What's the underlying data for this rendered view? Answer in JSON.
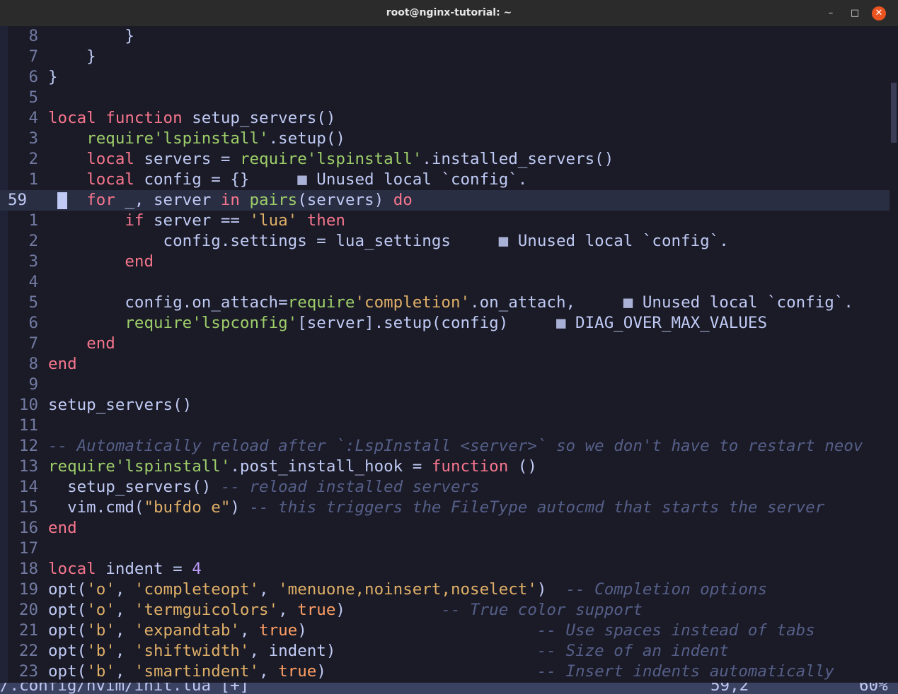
{
  "window": {
    "title": "root@nginx-tutorial: ~",
    "minimize_glyph": "–",
    "maximize_glyph": "□",
    "close_glyph": "✕"
  },
  "editor": {
    "cursor_line": "59",
    "lines": [
      {
        "ln": "8",
        "tokens": [
          [
            "        }",
            ""
          ]
        ]
      },
      {
        "ln": "7",
        "tokens": [
          [
            "    }",
            ""
          ]
        ]
      },
      {
        "ln": "6",
        "tokens": [
          [
            "}",
            ""
          ]
        ]
      },
      {
        "ln": "5",
        "tokens": []
      },
      {
        "ln": "4",
        "tokens": [
          [
            "local",
            "kw"
          ],
          [
            " ",
            ""
          ],
          [
            "function",
            "kw"
          ],
          [
            " setup_servers()",
            ""
          ]
        ]
      },
      {
        "ln": "3",
        "tokens": [
          [
            "    ",
            ""
          ],
          [
            "require",
            "req"
          ],
          [
            "'lspinstall'",
            "str"
          ],
          [
            ".setup()",
            ""
          ]
        ]
      },
      {
        "ln": "2",
        "tokens": [
          [
            "    ",
            ""
          ],
          [
            "local",
            "kw"
          ],
          [
            " servers = ",
            ""
          ],
          [
            "require",
            "req"
          ],
          [
            "'lspinstall'",
            "str"
          ],
          [
            ".installed_servers()",
            ""
          ]
        ]
      },
      {
        "ln": "1",
        "tokens": [
          [
            "    ",
            ""
          ],
          [
            "local",
            "kw"
          ],
          [
            " config = {}     ",
            ""
          ],
          [
            "■",
            "diagsq"
          ],
          [
            " Unused local `config`.",
            "diag"
          ]
        ]
      },
      {
        "ln": "59",
        "current": true,
        "tokens": [
          [
            "    ",
            ""
          ],
          [
            "for",
            "kw"
          ],
          [
            " _, server ",
            ""
          ],
          [
            "in",
            "kw"
          ],
          [
            " ",
            ""
          ],
          [
            "pairs",
            "req"
          ],
          [
            "(servers) ",
            ""
          ],
          [
            "do",
            "kw"
          ]
        ]
      },
      {
        "ln": "1",
        "tokens": [
          [
            "        ",
            ""
          ],
          [
            "if",
            "kw"
          ],
          [
            " server == ",
            ""
          ],
          [
            "'lua'",
            "str2"
          ],
          [
            " ",
            ""
          ],
          [
            "then",
            "kw"
          ]
        ]
      },
      {
        "ln": "2",
        "tokens": [
          [
            "            config.settings = lua_settings     ",
            ""
          ],
          [
            "■",
            "diagsq"
          ],
          [
            " Unused local `config`.",
            "diag"
          ]
        ]
      },
      {
        "ln": "3",
        "tokens": [
          [
            "        ",
            ""
          ],
          [
            "end",
            "kw"
          ]
        ]
      },
      {
        "ln": "4",
        "tokens": []
      },
      {
        "ln": "5",
        "tokens": [
          [
            "        config.on_attach=",
            ""
          ],
          [
            "require",
            "req"
          ],
          [
            "'completion'",
            "str2"
          ],
          [
            ".on_attach,     ",
            ""
          ],
          [
            "■",
            "diagsq"
          ],
          [
            " Unused local `config`.",
            "diag"
          ]
        ]
      },
      {
        "ln": "6",
        "tokens": [
          [
            "        ",
            ""
          ],
          [
            "require",
            "req"
          ],
          [
            "'lspconfig'",
            "str"
          ],
          [
            "[server].setup(config)     ",
            ""
          ],
          [
            "■",
            "diagsq"
          ],
          [
            " DIAG_OVER_MAX_VALUES",
            "diag"
          ]
        ]
      },
      {
        "ln": "7",
        "tokens": [
          [
            "    ",
            ""
          ],
          [
            "end",
            "kw"
          ]
        ]
      },
      {
        "ln": "8",
        "tokens": [
          [
            "end",
            "kw"
          ]
        ]
      },
      {
        "ln": "9",
        "tokens": []
      },
      {
        "ln": "10",
        "tokens": [
          [
            "setup_servers()",
            ""
          ]
        ]
      },
      {
        "ln": "11",
        "tokens": []
      },
      {
        "ln": "12",
        "tokens": [
          [
            "-- Automatically reload after `:LspInstall <server>` so we don't have to restart neov",
            "cmt"
          ]
        ]
      },
      {
        "ln": "13",
        "tokens": [
          [
            "require",
            "req"
          ],
          [
            "'lspinstall'",
            "str"
          ],
          [
            ".post_install_hook = ",
            ""
          ],
          [
            "function",
            "kw"
          ],
          [
            " ()",
            ""
          ]
        ]
      },
      {
        "ln": "14",
        "tokens": [
          [
            "  setup_servers() ",
            ""
          ],
          [
            "-- reload installed servers",
            "cmt"
          ]
        ]
      },
      {
        "ln": "15",
        "tokens": [
          [
            "  vim.cmd(",
            ""
          ],
          [
            "\"bufdo e\"",
            "str2"
          ],
          [
            ") ",
            ""
          ],
          [
            "-- this triggers the FileType autocmd that starts the server",
            "cmt"
          ]
        ]
      },
      {
        "ln": "16",
        "tokens": [
          [
            "end",
            "kw"
          ]
        ]
      },
      {
        "ln": "17",
        "tokens": []
      },
      {
        "ln": "18",
        "tokens": [
          [
            "local",
            "kw"
          ],
          [
            " indent = ",
            ""
          ],
          [
            "4",
            "num"
          ]
        ]
      },
      {
        "ln": "19",
        "tokens": [
          [
            "opt(",
            ""
          ],
          [
            "'o'",
            "str2"
          ],
          [
            ", ",
            ""
          ],
          [
            "'completeopt'",
            "str2"
          ],
          [
            ", ",
            ""
          ],
          [
            "'menuone,noinsert,noselect'",
            "str2"
          ],
          [
            ")  ",
            ""
          ],
          [
            "-- Completion options",
            "cmt"
          ]
        ]
      },
      {
        "ln": "20",
        "tokens": [
          [
            "opt(",
            ""
          ],
          [
            "'o'",
            "str2"
          ],
          [
            ", ",
            ""
          ],
          [
            "'termguicolors'",
            "str2"
          ],
          [
            ", ",
            ""
          ],
          [
            "true",
            "tbool"
          ],
          [
            ")          ",
            ""
          ],
          [
            "-- True color support",
            "cmt"
          ]
        ]
      },
      {
        "ln": "21",
        "tokens": [
          [
            "opt(",
            ""
          ],
          [
            "'b'",
            "str2"
          ],
          [
            ", ",
            ""
          ],
          [
            "'expandtab'",
            "str2"
          ],
          [
            ", ",
            ""
          ],
          [
            "true",
            "tbool"
          ],
          [
            ")                        ",
            ""
          ],
          [
            "-- Use spaces instead of tabs",
            "cmt"
          ]
        ]
      },
      {
        "ln": "22",
        "tokens": [
          [
            "opt(",
            ""
          ],
          [
            "'b'",
            "str2"
          ],
          [
            ", ",
            ""
          ],
          [
            "'shiftwidth'",
            "str2"
          ],
          [
            ", indent)                     ",
            ""
          ],
          [
            "-- Size of an indent",
            "cmt"
          ]
        ]
      },
      {
        "ln": "23",
        "tokens": [
          [
            "opt(",
            ""
          ],
          [
            "'b'",
            "str2"
          ],
          [
            ", ",
            ""
          ],
          [
            "'smartindent'",
            "str2"
          ],
          [
            ", ",
            ""
          ],
          [
            "true",
            "tbool"
          ],
          [
            ")                      ",
            ""
          ],
          [
            "-- Insert indents automatically",
            "cmt"
          ]
        ]
      }
    ]
  },
  "statusline": {
    "file": "/.config/nvim/init.lua [+]",
    "position": "59,2",
    "percent": "60%"
  },
  "colors": {
    "background": "#1a1b26",
    "keyword": "#f7768e",
    "string": "#9ece6a",
    "comment": "#565f89",
    "close_button": "#e95420"
  }
}
